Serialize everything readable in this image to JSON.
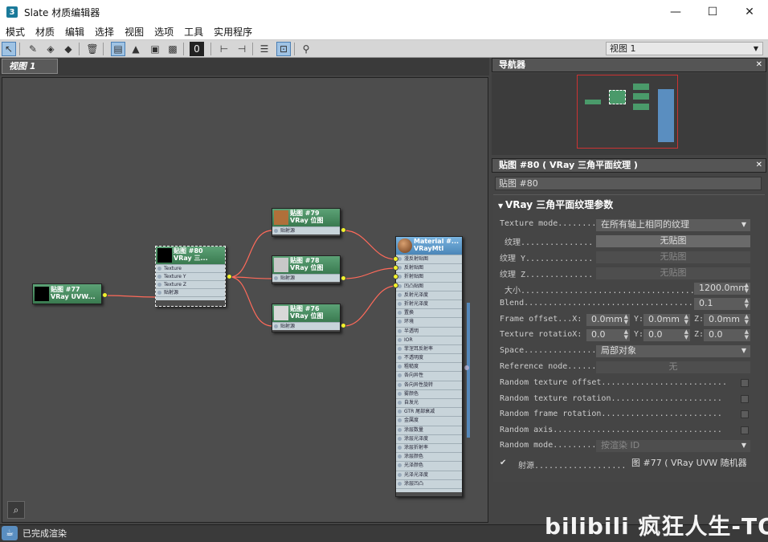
{
  "app": {
    "icon": "3",
    "title": "Slate 材质编辑器"
  },
  "window": {
    "minimize": "—",
    "maximize": "☐",
    "close": "✕"
  },
  "menu": [
    "模式",
    "材质",
    "编辑",
    "选择",
    "视图",
    "选项",
    "工具",
    "实用程序"
  ],
  "toolbar": {
    "view_select": "视图 1"
  },
  "view_tab": "视图 1",
  "navigator": {
    "title": "导航器"
  },
  "nodes": {
    "n77": {
      "title": "贴图 #77",
      "subtitle": "VRay UVW..."
    },
    "n80": {
      "title": "贴图 #80",
      "subtitle": "VRay 三...",
      "slots": [
        "Texture",
        "Texture Y",
        "Texture Z",
        "贴射源"
      ]
    },
    "n79": {
      "title": "贴图 #79",
      "subtitle": "VRay 位图",
      "slots": [
        "贴射源"
      ]
    },
    "n78": {
      "title": "贴图 #78",
      "subtitle": "VRay 位图",
      "slots": [
        "贴射源"
      ]
    },
    "n76": {
      "title": "贴图 #76",
      "subtitle": "VRay 位图",
      "slots": [
        "贴射源"
      ]
    },
    "mat": {
      "title": "Material #...",
      "subtitle": "VRayMtl",
      "slots": [
        "漫反射贴图",
        "反射贴图",
        "折射贴图",
        "凹凸贴图",
        "反射光泽度",
        "折射光泽度",
        "置换",
        "环境",
        "半透明",
        "IOR",
        "菲涅耳反射率",
        "不透明度",
        "粗糙度",
        "各向异性",
        "各向异性旋转",
        "雾颜色",
        "自发光",
        "GTR 尾部衰减",
        "金属度",
        "涂层数量",
        "涂层光泽度",
        "涂层折射率",
        "涂层颜色",
        "光泽颜色",
        "光泽光泽度",
        "涂层凹凸"
      ]
    }
  },
  "props": {
    "header": "贴图 #80 ( VRay 三角平面纹理 )",
    "name": "贴图 #80",
    "rollout_title": "VRay 三角平面纹理参数",
    "texture_mode_label": "Texture mode.........",
    "texture_mode_value": "在所有轴上相同的纹理",
    "texture_label": "纹理...............",
    "texture_value": "无贴图",
    "texture_y_label": "纹理 Y..............",
    "texture_y_value": "无贴图",
    "texture_z_label": "纹理 Z..............",
    "texture_z_value": "无贴图",
    "size_label": "大小.....................................",
    "size_value": "1200.0mm",
    "blend_label": "Blend.....................................",
    "blend_value": "0.1",
    "frame_offset_label": "Frame offset...X:",
    "fo_x": "0.0mm",
    "fo_y_label": "Y:",
    "fo_y": "0.0mm",
    "fo_z_label": "Z:",
    "fo_z": "0.0mm",
    "tex_rot_label": "Texture rotatioX:",
    "tr_x": "0.0",
    "tr_y_label": "Y:",
    "tr_y": "0.0",
    "tr_z_label": "Z:",
    "tr_z": "0.0",
    "space_label": "Space...............",
    "space_value": "局部对象",
    "ref_node_label": "Reference node......",
    "ref_node_value": "无",
    "rand_tex_offset": "Random texture offset..........................",
    "rand_tex_rot": "Random texture rotation.......................",
    "rand_frame_rot": "Random frame rotation.........................",
    "rand_axis": "Random axis...................................",
    "rand_mode_label": "Random mode.........",
    "rand_mode_value": "按渲染 ID",
    "projection_label": "射源...................",
    "projection_value": "图 #77  ( VRay UVW 随机器"
  },
  "status": "已完成渲染",
  "watermark": "bilibili 疯狂人生-TOP"
}
